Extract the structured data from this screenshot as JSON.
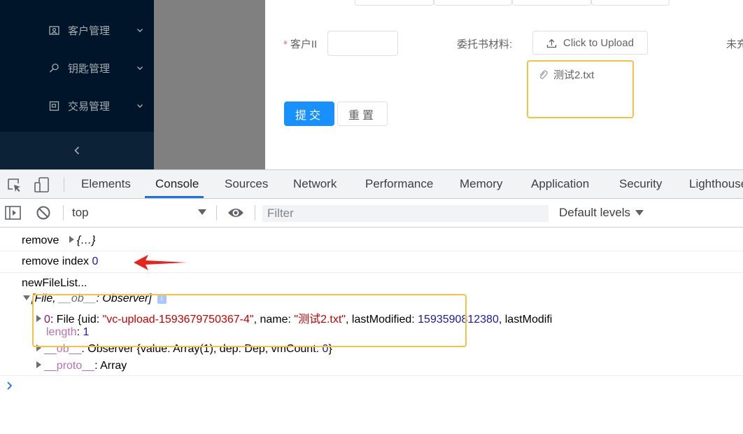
{
  "colors": {
    "sidebar_bg": "#001529",
    "primary": "#1890ff",
    "highlight_box": "#f5c242",
    "arrow": "#e8231b",
    "devtools_accent": "#1a73e8"
  },
  "sidebar": {
    "items": [
      {
        "label": "客户管理",
        "icon": "customer-icon"
      },
      {
        "label": "钥匙管理",
        "icon": "key-icon"
      },
      {
        "label": "交易管理",
        "icon": "transaction-icon"
      }
    ],
    "collapse_icon": "chevron-left-icon"
  },
  "form": {
    "customer_label": "客户II",
    "customer_required_mark": "*",
    "customer_value": "",
    "material_label": "委托书材料:",
    "upload_button": "Click to Upload",
    "uploaded_file": "测试2.txt",
    "cut_off_label": "未充",
    "submit_button": "提交",
    "reset_button": "重置"
  },
  "devtools": {
    "tabs": [
      "Elements",
      "Console",
      "Sources",
      "Network",
      "Performance",
      "Memory",
      "Application",
      "Security",
      "Lighthouse"
    ],
    "active_tab": "Console",
    "context": "top",
    "filter_placeholder": "Filter",
    "levels": "Default levels",
    "console": {
      "line1_text": "remove",
      "line1_obj": "{…}",
      "line2_text": "remove index",
      "line2_num": "0",
      "line3_text": "newFileList...",
      "array_summary_open": "[File, ",
      "array_summary_ob": "__ob__",
      "array_summary_close": ": Observer]",
      "info_badge": "i",
      "item0_key": "0",
      "item0_head": ": File {uid: ",
      "item0_uid": "\"vc-upload-1593679750367-4\"",
      "item0_mid": ", name: ",
      "item0_name": "\"测试2.txt\"",
      "item0_mid2": ", lastModified: ",
      "item0_lm": "1593590812380",
      "item0_tail": ", lastModifi",
      "length_key": "length",
      "length_val": "1",
      "ob_key": "__ob__",
      "ob_head": ": Observer {value: Array(1), dep: Dep, vmCount: ",
      "ob_count": "0",
      "ob_close": "}",
      "proto_key": "__proto__",
      "proto_val": ": Array"
    }
  }
}
